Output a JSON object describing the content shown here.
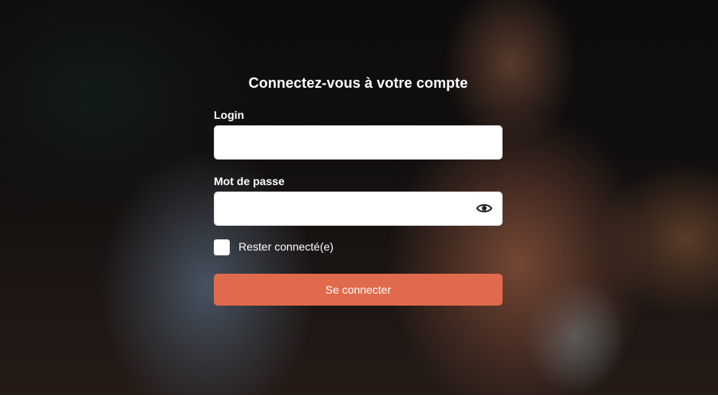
{
  "login_form": {
    "title": "Connectez-vous à votre compte",
    "login_label": "Login",
    "login_value": "",
    "password_label": "Mot de passe",
    "password_value": "",
    "remember_label": "Rester connecté(e)",
    "remember_checked": false,
    "submit_label": "Se connecter"
  },
  "icons": {
    "password_toggle": "eye-icon"
  },
  "colors": {
    "accent": "#e06a4c",
    "text": "#ffffff",
    "input_background": "#ffffff"
  }
}
